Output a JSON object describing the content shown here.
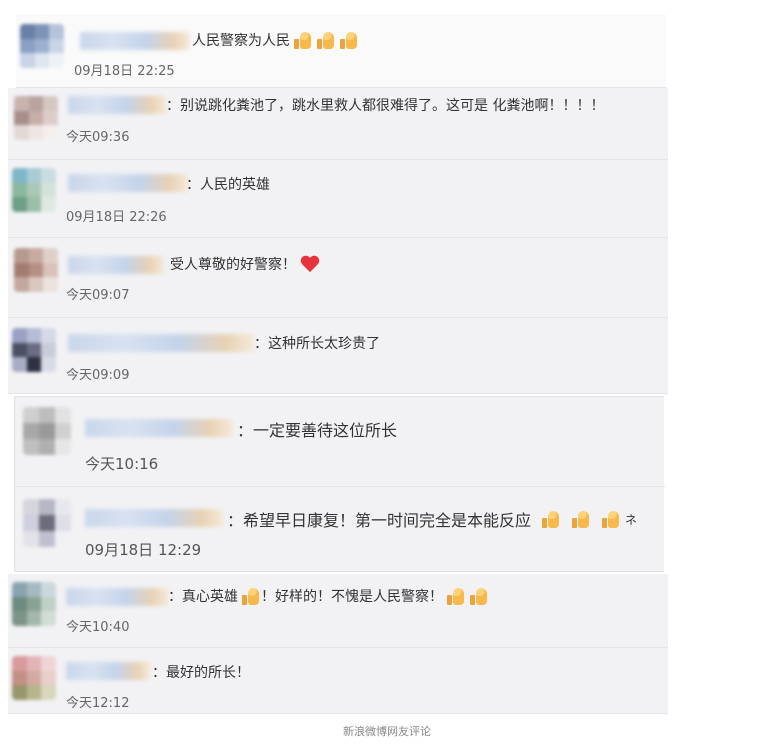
{
  "caption": "新浪微博网友评论",
  "comments": [
    {
      "text": "人民警察为人民",
      "thumbs": 3,
      "time": "09月18日 22:25",
      "avatar": [
        "#6a80a8",
        "#7e93b8",
        "#b5c3da",
        "#8aa0c4",
        "#9db0cf",
        "#c9d4e6",
        "#c8d3e5",
        "#dfe6f0",
        "#eef2f7"
      ]
    },
    {
      "text": "：别说跳化粪池了，跳水里救人都很难得了。这可是 化粪池啊！！！！",
      "time": "今天09:36",
      "avatar": [
        "#c9b3b0",
        "#b8a39f",
        "#d6c7c3",
        "#a88f8a",
        "#c7aea8",
        "#dccdc9",
        "#e3d8d5",
        "#eee6e3",
        "#f4efed"
      ]
    },
    {
      "text": "：人民的英雄",
      "time": "09月18日 22:26",
      "avatar": [
        "#7fb7c9",
        "#a8cbd4",
        "#c7dde2",
        "#8cb89f",
        "#a9c8b5",
        "#d4e3d9",
        "#6f9e87",
        "#9bbfa9",
        "#dfe9e2"
      ]
    },
    {
      "text": "受人尊敬的好警察！",
      "heart": true,
      "time": "今天09:07",
      "avatar": [
        "#b79a8f",
        "#c7aba2",
        "#e0cfc9",
        "#a27d6f",
        "#b58f82",
        "#d8c2ba",
        "#c2a89e",
        "#dac8c1",
        "#ece2de"
      ]
    },
    {
      "text": "：这种所长太珍贵了",
      "time": "今天09:09",
      "avatar": [
        "#9aa1c4",
        "#b6bbd6",
        "#d5d8e8",
        "#4d4f63",
        "#6a6d84",
        "#c9cbd9",
        "#a9adc4",
        "#2f3142",
        "#d8dae6"
      ]
    },
    {
      "text": "：一定要善待这位所长",
      "time": "今天10:16",
      "avatar": [
        "#cfcfcf",
        "#bdbdbd",
        "#e2e2e2",
        "#a8a8a8",
        "#9a9a9a",
        "#d0d0d0",
        "#bfbfbf",
        "#b0b0b0",
        "#e6e6e6"
      ]
    },
    {
      "text": "：希望早日康复！第一时间完全是本能反应",
      "thumbs": 3,
      "time": "09月18日 12:29",
      "avatar": [
        "#d5d5dd",
        "#b6b6c4",
        "#e7e7ee",
        "#cfcfe0",
        "#6c6c7a",
        "#dedee8",
        "#e2e2ea",
        "#bfbfcf",
        "#f0f0f5"
      ]
    },
    {
      "text": "：真心英雄",
      "thumbs": 1,
      "text2": "！好样的！不愧是人民警察！",
      "thumbs2": 2,
      "time": "今天10:40",
      "avatar": [
        "#8aa4b0",
        "#a6b9c1",
        "#ccd8dd",
        "#6f8a80",
        "#8aa295",
        "#bfd0c6",
        "#7b9486",
        "#a3b7ab",
        "#d2ddd6"
      ]
    },
    {
      "text": "：最好的所长！",
      "time": "今天12:12",
      "avatar": [
        "#d99a9e",
        "#e3b4b6",
        "#f0d4d5",
        "#c48f86",
        "#d3a9a2",
        "#e8cfca",
        "#98976b",
        "#b7b58d",
        "#d8d6bb"
      ]
    }
  ],
  "trailing_char": "ネ"
}
